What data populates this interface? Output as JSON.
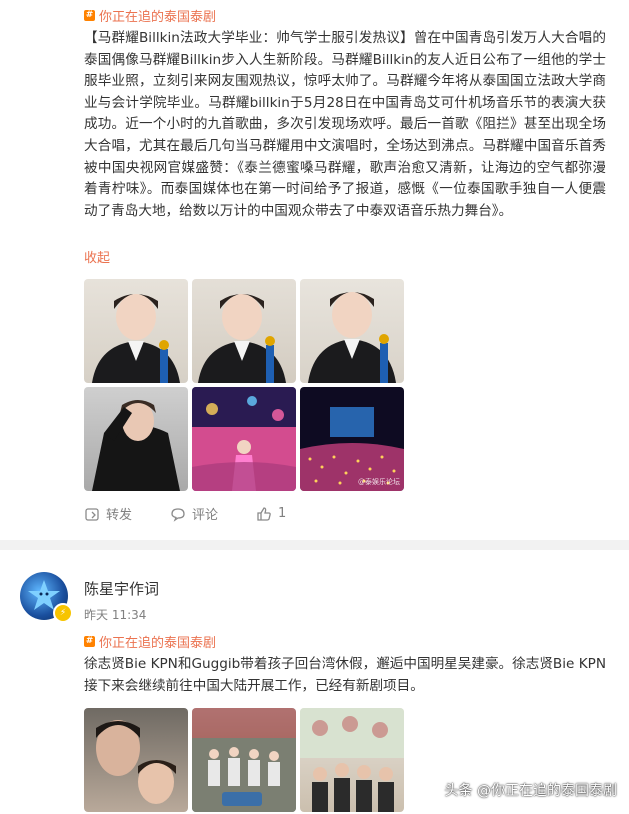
{
  "post1": {
    "topic": "你正在追的泰国泰剧",
    "text": "【马群耀Billkin法政大学毕业：帅气学士服引发热议】曾在中国青岛引发万人大合唱的泰国偶像马群耀Billkin步入人生新阶段。马群耀Billkin的友人近日公布了一组他的学士服毕业照，立刻引来网友围观热议，惊呼太帅了。马群耀今年将从泰国国立法政大学商业与会计学院毕业。马群耀billkin于5月28日在中国青岛艾可什机场音乐节的表演大获成功。近一个小时的九首歌曲，多次引发现场欢呼。最后一首歌《阻拦》甚至出现全场大合唱，尤其在最后几句当马群耀用中文演唱时，全场达到沸点。马群耀中国音乐首秀被中国央视网官媒盛赞：《泰兰德蜜嗓马群耀，歌声治愈又清新，让海边的空气都弥漫着青柠味》。而泰国媒体也在第一时间给予了报道，感慨《一位泰国歌手独自一人便震动了青岛大地，给数以万计的中国观众带去了中泰双语音乐热力舞台》。",
    "collapse": "收起",
    "photos": [
      "graduation-portrait-1",
      "graduation-portrait-2",
      "graduation-portrait-3",
      "black-outfit-portrait",
      "concert-stage-pink-outfit",
      "concert-crowd-night"
    ],
    "photo_watermark": "@泰娱乐论坛",
    "actions": {
      "repost": "转发",
      "comment": "评论",
      "like_count": "1"
    }
  },
  "post2": {
    "author": "陈星宇作词",
    "time": "昨天 11:34",
    "topic": "你正在追的泰国泰剧",
    "text": "徐志贤Bie KPN和Guggib带着孩子回台湾休假，邂逅中国明星吴建豪。徐志贤Bie KPN接下来会继续前往中国大陆开展工作，已经有新剧项目。",
    "photos": [
      "selfie-couple",
      "street-group-photo",
      "restaurant-group-photo"
    ]
  },
  "watermark": "头条 @你正在追的泰国泰剧",
  "colors": {
    "link": "#eb7350",
    "text": "#333333",
    "muted": "#808080",
    "divider": "#f2f2f2"
  }
}
